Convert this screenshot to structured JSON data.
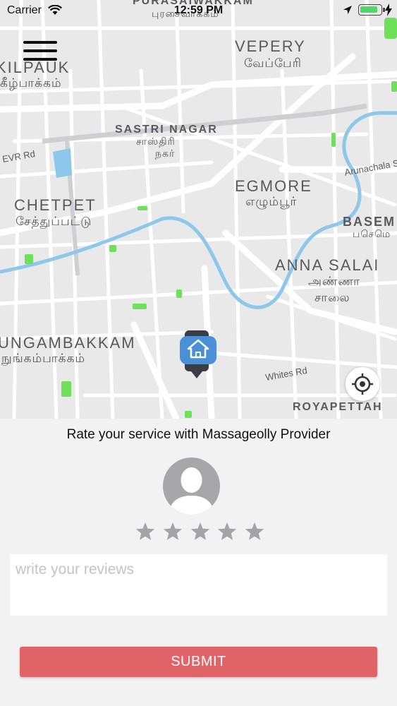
{
  "status_bar": {
    "carrier": "Carrier",
    "time": "12:59 PM",
    "battery_level": 0.9
  },
  "map": {
    "labels": {
      "purasaiwakkam": "PURASAIWAKKAM",
      "purasaiwakkam_ta": "புரசைவாக்கம்",
      "vepery": "VEPERY",
      "vepery_ta": "வேப்பேரி",
      "kilpauk": "KILPAUK",
      "kilpauk_ta": "கீழ்பாக்கம்",
      "sastri_nagar": "SASTRI NAGAR",
      "sastri_nagar_ta1": "சாஸ்திரி",
      "sastri_nagar_ta2": "நகர்",
      "evr_rd": "EVR Rd",
      "egmore": "EGMORE",
      "egmore_ta": "எழும்பூர்",
      "arunachala": "Arunachala S",
      "chetpet": "CHETPET",
      "chetpet_ta": "சேத்துப்பட்டு",
      "basem": "BASEM",
      "basem_ta": "பசெமெ",
      "anna_salai": "ANNA SALAI",
      "anna_salai_ta1": "அண்ணா",
      "anna_salai_ta2": "சாலை",
      "nungambakkam": "UNGAMBAKKAM",
      "nungambakkam_ta": "நுங்கம்பாக்கம்",
      "whites_rd": "Whites Rd",
      "royapettah": "ROYAPETTAH"
    },
    "icons": {
      "menu": "hamburger-menu-icon",
      "pin": "home-location-pin-icon",
      "locate": "crosshair-locate-icon"
    },
    "colors": {
      "road": "#ffffff",
      "water": "#8dc7e9",
      "park": "#6ee05a",
      "base": "#e9e9ea",
      "pin": "#4a90d9"
    }
  },
  "rating": {
    "title": "Rate your service with Massageolly Provider",
    "stars_total": 5,
    "stars_selected": 0,
    "review_placeholder": "write your reviews",
    "submit_label": "SUBMIT",
    "colors": {
      "submit": "#e06467",
      "star": "#a4a4a7",
      "avatar": "#a7a7aa"
    }
  }
}
